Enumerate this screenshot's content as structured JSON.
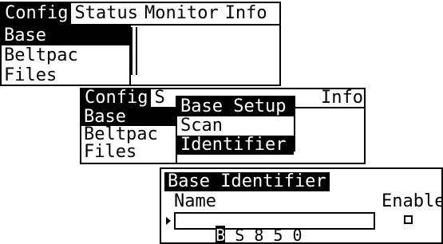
{
  "screen1": {
    "menu": [
      "Config",
      "Status",
      "Monitor",
      "Info"
    ],
    "items": [
      "Base",
      "Beltpac",
      "Files"
    ]
  },
  "screen2": {
    "menu_left": "Config",
    "menu_partial": "S",
    "menu_right": "Info",
    "items": [
      "Base",
      "Beltpac",
      "Files"
    ],
    "popup": {
      "title": "Base Setup",
      "items": [
        "Scan",
        "Identifier"
      ]
    }
  },
  "screen3": {
    "title": "Base Identifier",
    "name_label": "Name",
    "enable_label": "Enable",
    "name_first_char": "B",
    "name_rest": "S 8 5 0"
  }
}
